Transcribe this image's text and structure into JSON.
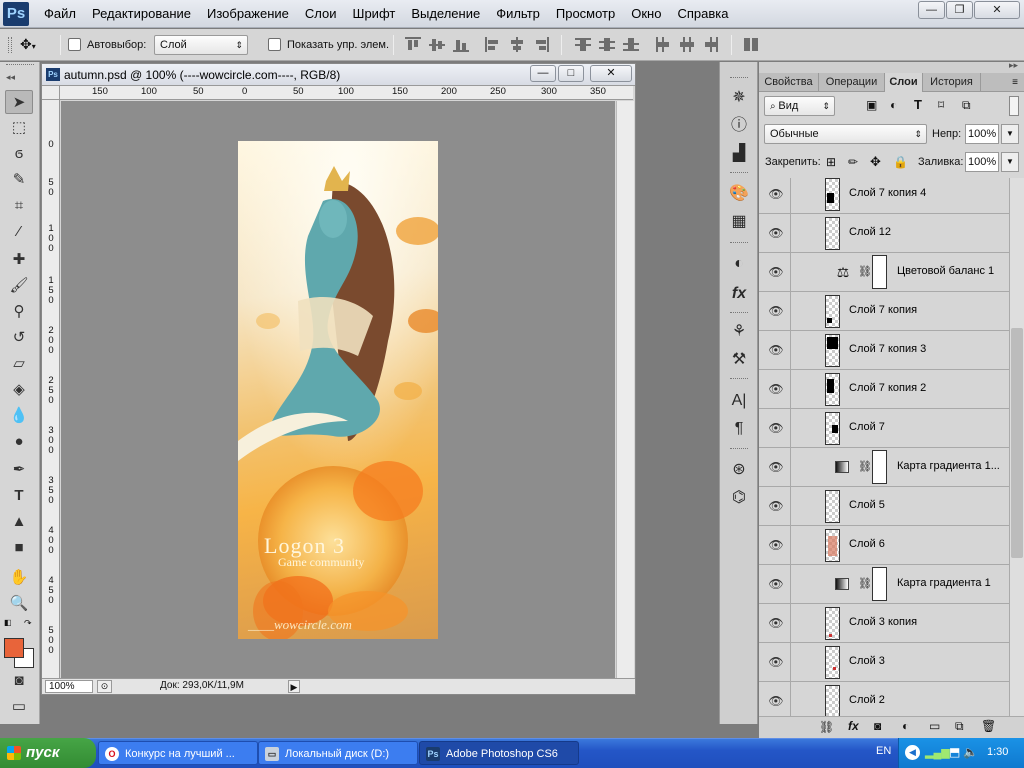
{
  "app": {
    "logo": "Ps",
    "menu": [
      "Файл",
      "Редактирование",
      "Изображение",
      "Слои",
      "Шрифт",
      "Выделение",
      "Фильтр",
      "Просмотр",
      "Окно",
      "Справка"
    ],
    "window_buttons": {
      "minimize": "—",
      "restore": "❐",
      "close": "✕"
    }
  },
  "options_bar": {
    "auto_select_label": "Автовыбор:",
    "auto_select_value": "Слой",
    "show_transform_label": "Показать упр. элем."
  },
  "document": {
    "title": "autumn.psd @ 100% (----wowcircle.com----, RGB/8)",
    "ruler_h": [
      "150",
      "100",
      "50",
      "0",
      "50",
      "100",
      "150",
      "200",
      "250",
      "300",
      "350"
    ],
    "ruler_v": [
      "0",
      "5 0",
      "1 0 0",
      "1 5 0",
      "2 0 0",
      "2 5 0",
      "3 0 0",
      "3 5 0",
      "4 0 0",
      "4 5 0",
      "5 0 0"
    ],
    "zoom": "100%",
    "doc_info": "Док: 293,0K/11,9M",
    "art_title": "Logon 3",
    "art_subtitle": "Game community",
    "art_watermark": "____wowcircle.com"
  },
  "panel": {
    "tabs": [
      "Свойства",
      "Операции",
      "Слои",
      "История"
    ],
    "active_tab": "Слои",
    "filter_label": "Вид",
    "blend_mode": "Обычные",
    "opacity_label": "Непр:",
    "opacity_value": "100%",
    "lock_label": "Закрепить:",
    "fill_label": "Заливка:",
    "fill_value": "100%",
    "layers": [
      {
        "name": "Слой 7 копия 4",
        "kind": "pixel"
      },
      {
        "name": "Слой 12",
        "kind": "pixel"
      },
      {
        "name": "Цветовой баланс 1",
        "kind": "adjust-balance"
      },
      {
        "name": "Слой 7 копия",
        "kind": "pixel"
      },
      {
        "name": "Слой 7 копия 3",
        "kind": "pixel"
      },
      {
        "name": "Слой 7 копия 2",
        "kind": "pixel"
      },
      {
        "name": "Слой 7",
        "kind": "pixel"
      },
      {
        "name": "Карта градиента 1...",
        "kind": "adjust-gradient"
      },
      {
        "name": "Слой 5",
        "kind": "pixel"
      },
      {
        "name": "Слой 6",
        "kind": "pixel"
      },
      {
        "name": "Карта градиента 1",
        "kind": "adjust-gradient"
      },
      {
        "name": "Слой 3 копия",
        "kind": "pixel"
      },
      {
        "name": "Слой 3",
        "kind": "pixel"
      },
      {
        "name": "Слой 2",
        "kind": "pixel"
      }
    ]
  },
  "taskbar": {
    "start": "пуск",
    "tasks": [
      {
        "label": "Конкурс на лучший ...",
        "icon": "opera-icon"
      },
      {
        "label": "Локальный диск (D:)",
        "icon": "drive-icon"
      },
      {
        "label": "Adobe Photoshop CS6",
        "icon": "photoshop-icon"
      }
    ],
    "lang": "EN",
    "clock": "1:30"
  },
  "colors": {
    "foreground": "#e8643a",
    "background": "#ffffff",
    "accent": "#1a3c6e"
  }
}
